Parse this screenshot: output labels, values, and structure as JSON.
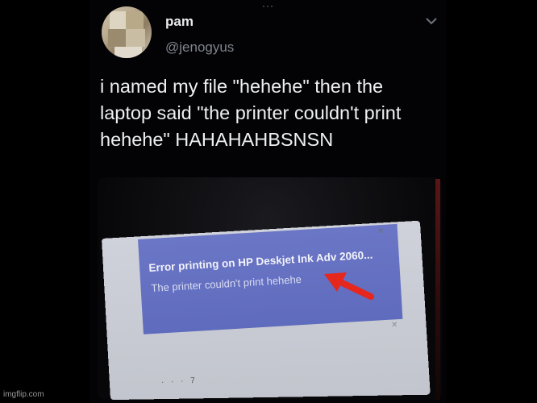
{
  "tweet": {
    "more_dots": "···",
    "author_name": "pam",
    "author_handle": "@jenogyus",
    "text": "i named my file \"hehehe\" then the laptop said \"the printer couldn't print hehehe\" HAHAHAHBSNSN",
    "menu_icon": "chevron-down-icon"
  },
  "photo": {
    "notification": {
      "title": "Error printing on HP Deskjet Ink Adv 2060...",
      "message": "The printer couldn't print hehehe",
      "accent_color": "#6470c2"
    },
    "close_glyph": "✕",
    "small_x": "✕",
    "ruler_text": "· · · 7",
    "arrow_color": "#e5271d"
  },
  "watermark": "imgflip.com"
}
